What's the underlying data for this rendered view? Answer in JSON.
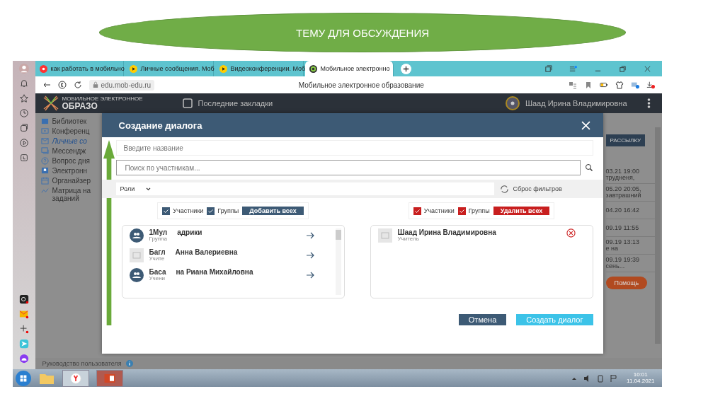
{
  "slide_title": "ТЕМУ ДЛЯ ОБСУЖДЕНИЯ",
  "browser": {
    "tabs": [
      {
        "label": "как работать в мобильно",
        "selected": false,
        "kind": "search"
      },
      {
        "label": "Личные сообщения. Моб",
        "selected": false,
        "kind": "video"
      },
      {
        "label": "Видеоконференции. Моб",
        "selected": false,
        "kind": "video"
      },
      {
        "label": "Мобильное электронно",
        "selected": true,
        "kind": "site"
      }
    ],
    "url": "edu.mob-edu.ru",
    "page_title": "Мобильное электронное образование"
  },
  "site": {
    "logo_top": "МОБИЛЬНОЕ ЭЛЕКТРОННОЕ",
    "logo_bottom": "ОБРАЗО",
    "bookmarks": "Последние закладки",
    "user": "Шаад Ирина Владимировна",
    "menu": [
      {
        "label": "Библиотек",
        "selected": false,
        "kind": "book"
      },
      {
        "label": "Конференц",
        "selected": false,
        "kind": "video"
      },
      {
        "label": "Личные со",
        "selected": true,
        "kind": "mail"
      },
      {
        "label": "Мессендж",
        "selected": false,
        "kind": "chat"
      },
      {
        "label": "Вопрос дня",
        "selected": false,
        "kind": "question"
      },
      {
        "label": "Электронн",
        "selected": false,
        "kind": "person"
      },
      {
        "label": "Органайзер",
        "selected": false,
        "kind": "calendar"
      },
      {
        "label": "Матрица на заданий",
        "selected": false,
        "kind": "chart"
      }
    ],
    "mailing_button": "РАССЫЛКУ",
    "messages": [
      {
        "date": "03.21 19:00",
        "text": "трудненя,"
      },
      {
        "date": "05.20 20:05,",
        "text": "завтрашний"
      },
      {
        "date": "04.20 16:42"
      },
      {
        "date": "09.19 11:55"
      },
      {
        "date": "09.19 13:13",
        "text": "е на"
      },
      {
        "date": "09.19 19:39",
        "text": "сень..."
      }
    ],
    "help_button": "Помощь",
    "guide": "Руководство пользователя"
  },
  "dialog": {
    "title": "Создание диалога",
    "name_placeholder": "Введите название",
    "search_placeholder": "Поиск по участникам...",
    "roles": "Роли",
    "reset": "Сброс фильтров",
    "left_filters": [
      {
        "label": "Участники",
        "checked": true
      },
      {
        "label": "Группы",
        "checked": true
      }
    ],
    "add_all": "Добавить всех",
    "right_filters": [
      {
        "label": "Участники",
        "checked": true
      },
      {
        "label": "Группы",
        "checked": true
      }
    ],
    "remove_all": "Удалить всех",
    "candidates": [
      {
        "name_parts": [
          "1Мул",
          "адрики"
        ],
        "role": "Группа",
        "kind": "group"
      },
      {
        "name_parts": [
          "Багл",
          "Анна Валериевна"
        ],
        "role": "Учите",
        "kind": "person"
      },
      {
        "name_parts": [
          "Баса",
          "на Риана Михайловна"
        ],
        "role": "Учени",
        "kind": "group"
      }
    ],
    "members": [
      {
        "name": "Шаад Ирина Владимировна",
        "role": "Учитель",
        "kind": "person"
      }
    ],
    "cancel": "Отмена",
    "create": "Создать диалог"
  },
  "taskbar": {
    "time": "10:01",
    "date": "11.04.2021"
  }
}
